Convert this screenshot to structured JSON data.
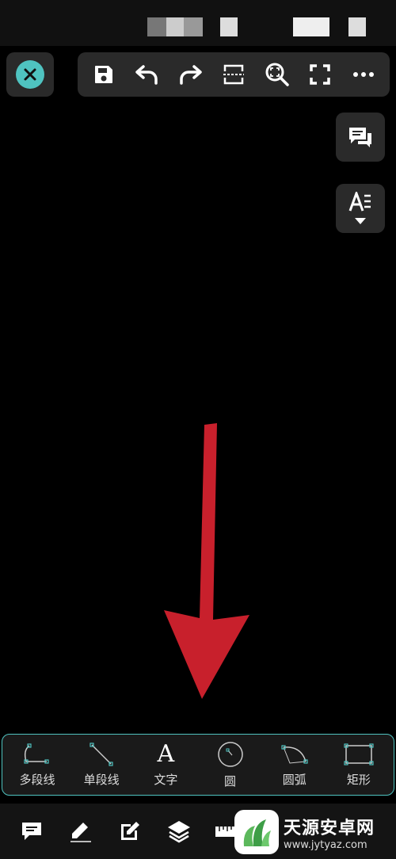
{
  "app": {
    "accent": "#4fc3c0",
    "arrow_color": "#c8202c"
  },
  "top_toolbar": {
    "icons": [
      "save-icon",
      "undo-icon",
      "redo-icon",
      "measure-icon",
      "zoom-icon",
      "fullscreen-icon",
      "more-icon"
    ]
  },
  "side": {
    "icons": [
      "comment-icon",
      "text-style-icon"
    ]
  },
  "draw_tools": {
    "polyline": "多段线",
    "line": "单段线",
    "text": "文字",
    "circle": "圆",
    "arc": "圆弧",
    "rect": "矩形",
    "text_glyph": "A"
  },
  "bottom_bar": {
    "icons": [
      "annotation-icon",
      "pen-icon",
      "edit-icon",
      "layers-icon",
      "ruler-icon"
    ]
  },
  "watermark": {
    "title": "天源安卓网",
    "url": "www.jytyaz.com"
  }
}
